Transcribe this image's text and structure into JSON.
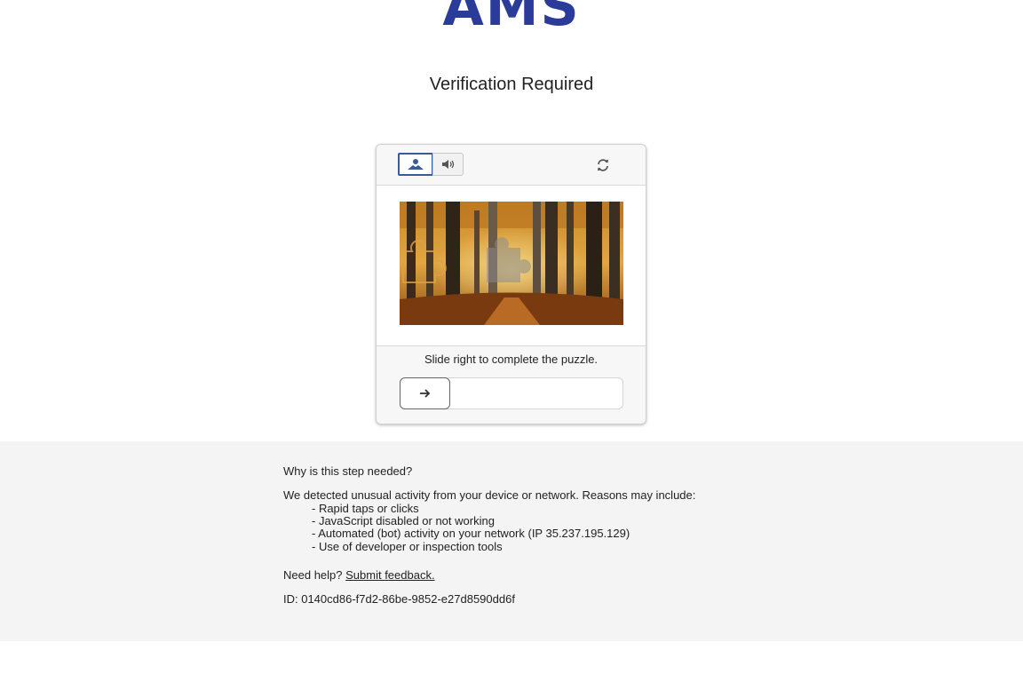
{
  "brand": {
    "logo_text": "AMS",
    "color": "#2a3b9a"
  },
  "page": {
    "title": "Verification Required"
  },
  "captcha": {
    "modes": [
      {
        "icon": "image-icon",
        "selected": true
      },
      {
        "icon": "speaker-icon",
        "selected": false
      }
    ],
    "refresh_icon": "refresh-icon",
    "image_description_icon": "puzzle-piece-icon",
    "instruction": "Slide right to complete the puzzle.",
    "slider": {
      "handle_icon": "arrow-right-icon",
      "progress": 0
    }
  },
  "info": {
    "question": "Why is this step needed?",
    "intro": "We detected unusual activity from your device or network. Reasons may include:",
    "reasons": [
      "- Rapid taps or clicks",
      "- JavaScript disabled or not working",
      "- Automated (bot) activity on your network (IP 35.237.195.129)",
      "- Use of developer or inspection tools"
    ],
    "help_prefix": "Need help?",
    "help_link": "Submit feedback.",
    "id_text": "ID: 0140cd86-f7d2-86be-9852-e27d8590dd6f"
  }
}
